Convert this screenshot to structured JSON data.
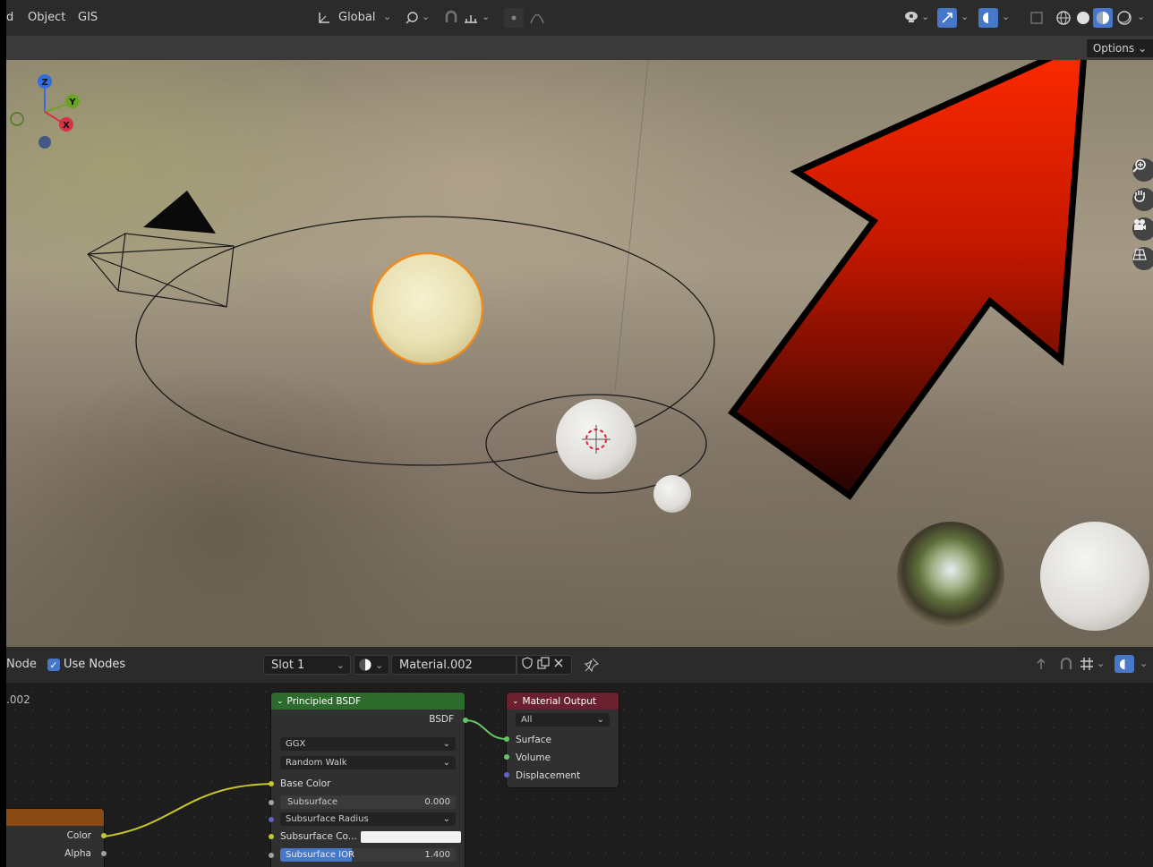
{
  "header": {
    "menu_partial": "d",
    "menu_object": "Object",
    "menu_gis": "GIS",
    "transform_orientation": "Global",
    "options_label": "Options"
  },
  "viewport": {
    "arrow_color": "#e42200",
    "gizmo_axes": {
      "z": "Z",
      "y": "Y",
      "x": "X"
    },
    "selection_outline_color": "#f08a1a"
  },
  "node_header": {
    "node_partial": "Node",
    "use_nodes_label": "Use Nodes",
    "use_nodes_checked": true,
    "slot": "Slot 1",
    "material_name": "Material.002"
  },
  "node_canvas": {
    "material_partial": ".002"
  },
  "principled_bsdf": {
    "title": "Principled BSDF",
    "header_color": "#2d6b2d",
    "output_label": "BSDF",
    "distribution": "GGX",
    "subsurface_method": "Random Walk",
    "inputs": {
      "base_color": "Base Color",
      "subsurface_label": "Subsurface",
      "subsurface_value": "0.000",
      "subsurface_radius": "Subsurface Radius",
      "subsurface_color_label": "Subsurface Co...",
      "subsurface_ior_label": "Subsurface IOR",
      "subsurface_ior_value": "1.400"
    }
  },
  "material_output": {
    "title": "Material Output",
    "header_color": "#6b2030",
    "target": "All",
    "inputs": [
      "Surface",
      "Volume",
      "Displacement"
    ]
  },
  "texture_node": {
    "header_color": "#8a4a14",
    "outputs": [
      "Color",
      "Alpha"
    ]
  }
}
